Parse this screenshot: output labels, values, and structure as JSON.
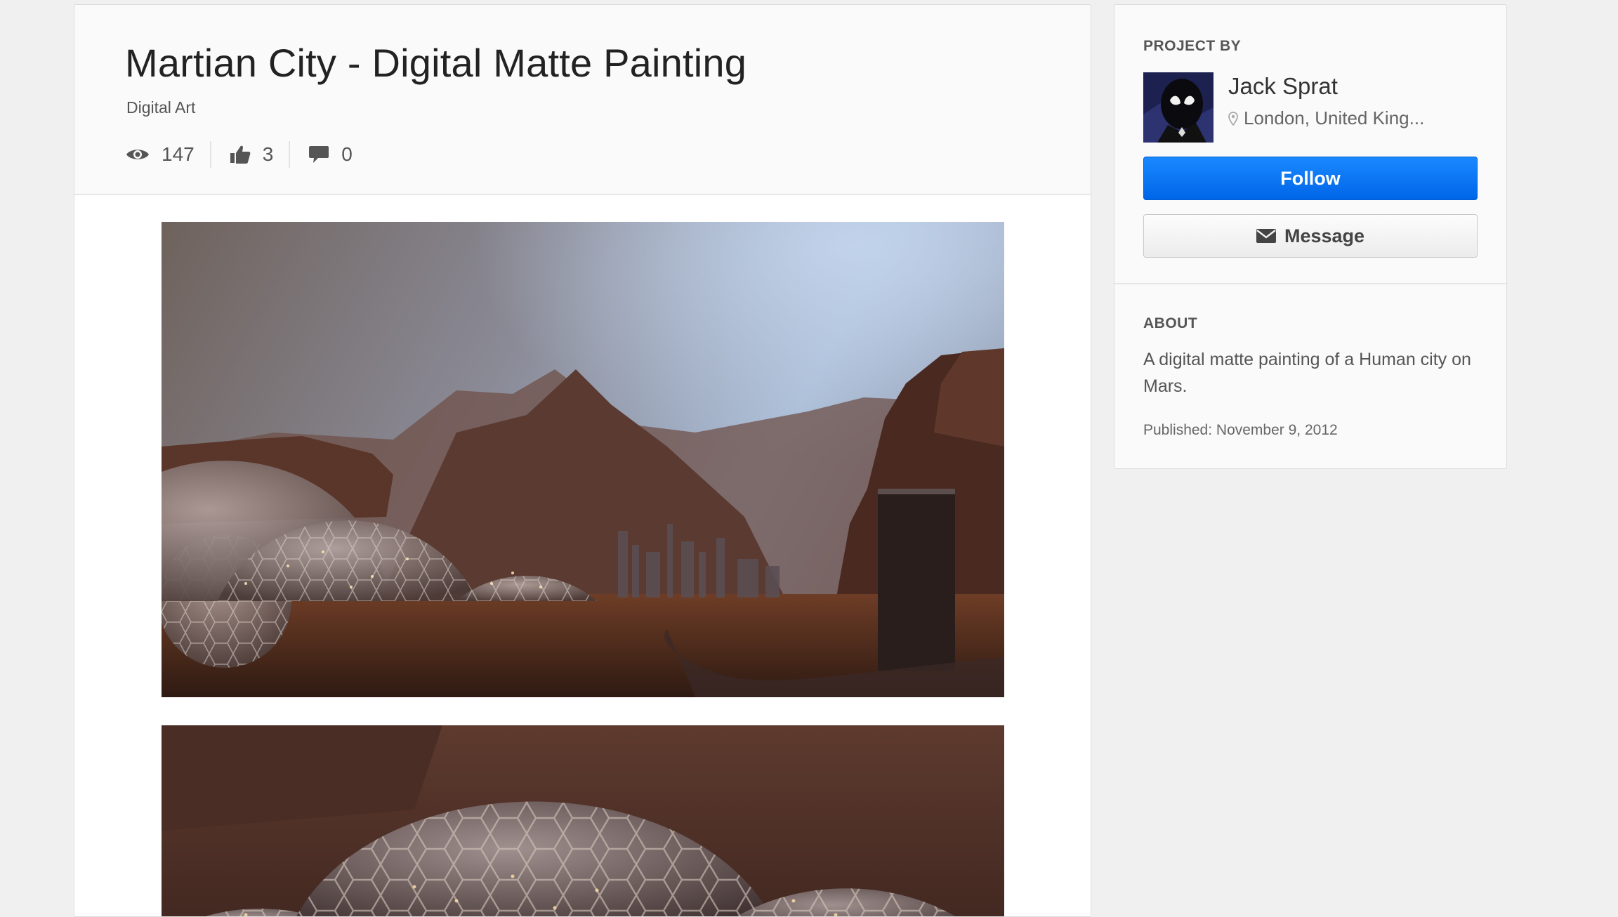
{
  "project": {
    "title": "Martian City - Digital Matte Painting",
    "category": "Digital Art",
    "stats": {
      "views": "147",
      "appreciations": "3",
      "comments": "0"
    }
  },
  "sidebar": {
    "project_by_label": "PROJECT BY",
    "owner": {
      "name": "Jack Sprat",
      "location": "London, United King..."
    },
    "follow_label": "Follow",
    "message_label": "Message",
    "about_label": "ABOUT",
    "about_text": "A digital matte painting of a Human city on Mars.",
    "published": "Published: November 9, 2012"
  },
  "icons": {
    "views": "eye-icon",
    "appreciations": "thumbs-up-icon",
    "comments": "speech-bubble-icon",
    "location": "map-pin-icon",
    "message": "envelope-icon"
  },
  "colors": {
    "accent": "#0a74f5",
    "page_background": "#f0f0f0",
    "card_header": "#fafafa"
  }
}
